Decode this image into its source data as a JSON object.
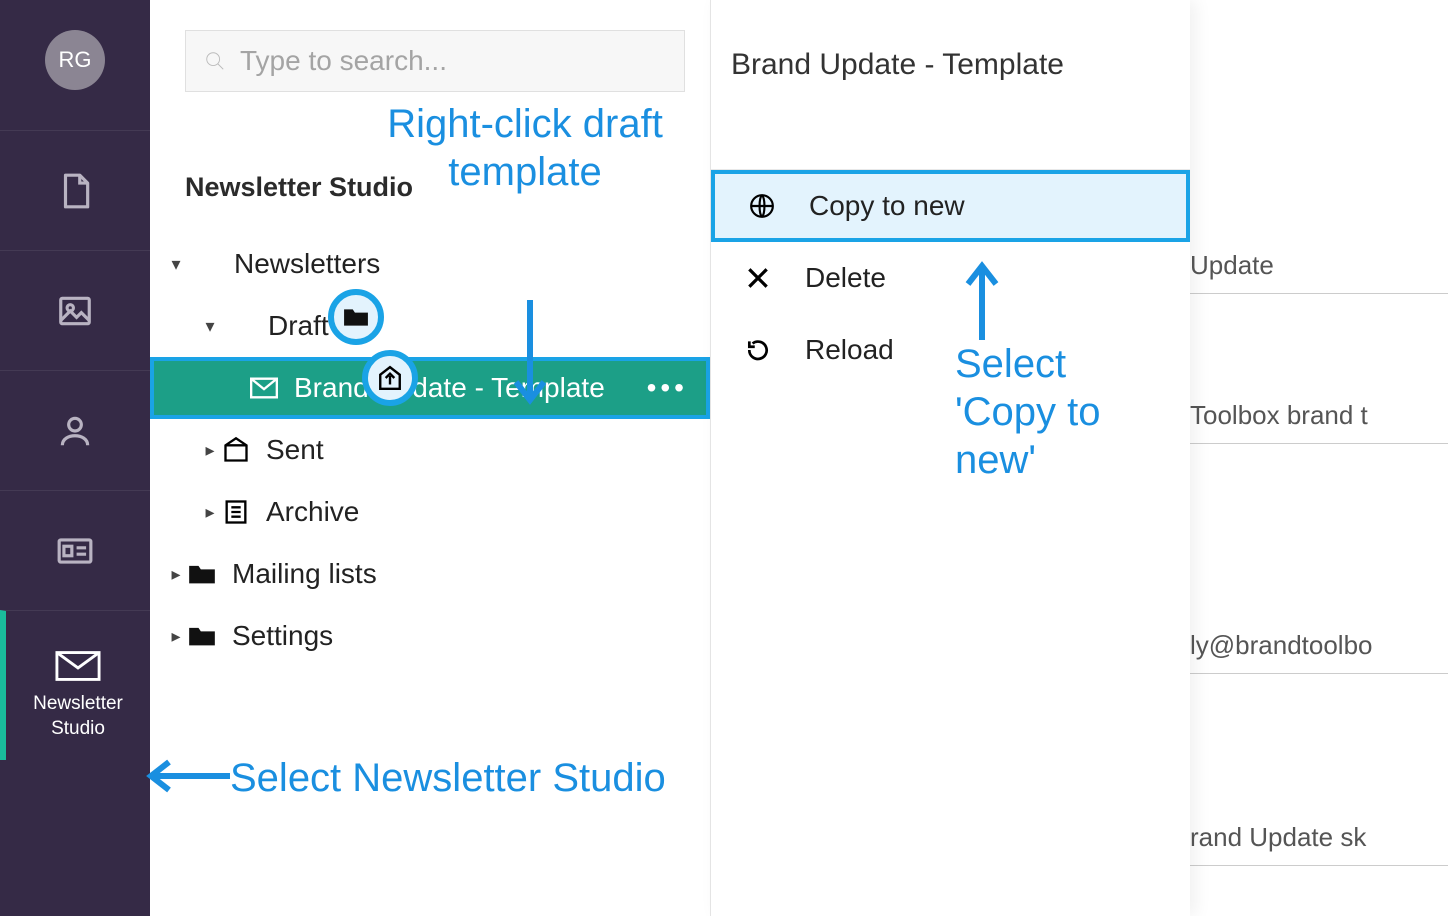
{
  "avatar": {
    "initials": "RG"
  },
  "search": {
    "placeholder": "Type to search..."
  },
  "panel": {
    "title": "Newsletter Studio"
  },
  "nav": {
    "newsletter_studio_label": "Newsletter Studio"
  },
  "tree": {
    "newsletters": "Newsletters",
    "draft": "Draft",
    "draft_item": "Brand Update - Template",
    "sent": "Sent",
    "archive": "Archive",
    "mailing_lists": "Mailing lists",
    "settings": "Settings"
  },
  "context_menu": {
    "header": "Brand Update - Template",
    "copy": "Copy to new",
    "delete": "Delete",
    "reload": "Reload"
  },
  "right_bg": {
    "r1": "Update",
    "r2": "Toolbox brand t",
    "r3": "ly@brandtoolbo",
    "r4": "rand Update sk"
  },
  "annotations": {
    "right_click": "Right-click draft template",
    "select_copy": "Select 'Copy to new'",
    "select_ns": "Select Newsletter Studio"
  }
}
